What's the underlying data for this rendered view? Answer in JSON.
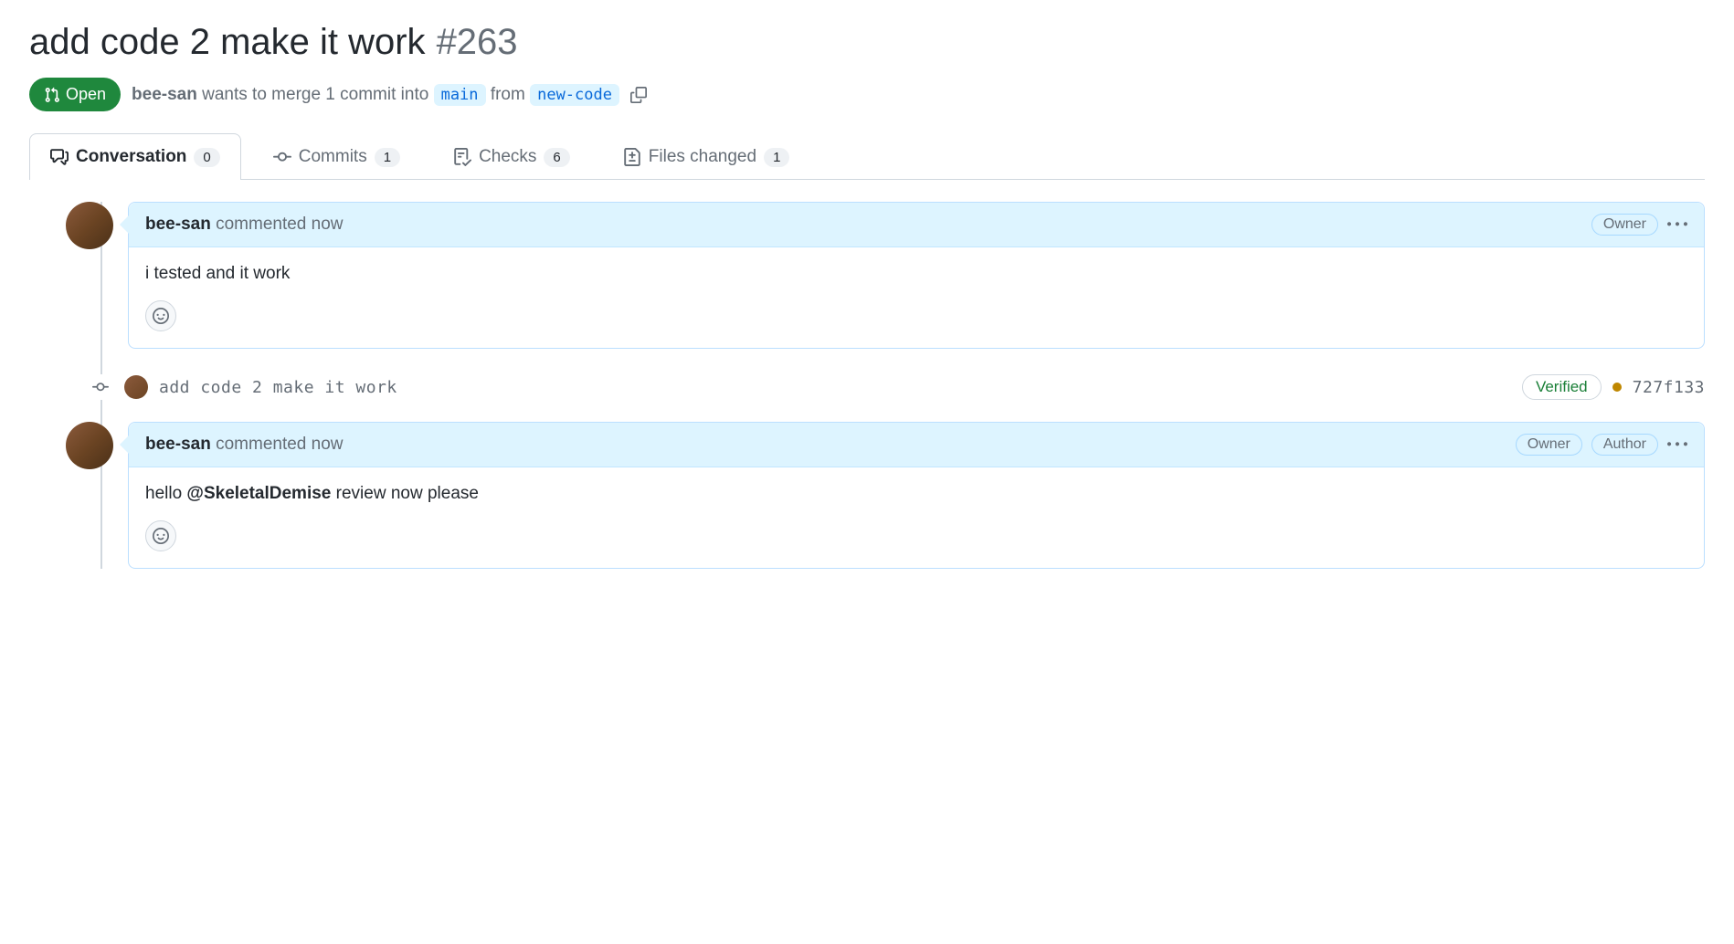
{
  "pr": {
    "title": "add code 2 make it work",
    "number": "#263",
    "state": "Open",
    "author": "bee-san",
    "merge_text_1": "wants to merge 1 commit into",
    "base_branch": "main",
    "merge_text_2": "from",
    "head_branch": "new-code"
  },
  "tabs": {
    "conversation": {
      "label": "Conversation",
      "count": "0"
    },
    "commits": {
      "label": "Commits",
      "count": "1"
    },
    "checks": {
      "label": "Checks",
      "count": "6"
    },
    "files": {
      "label": "Files changed",
      "count": "1"
    }
  },
  "comments": [
    {
      "author": "bee-san",
      "action": "commented",
      "time": "now",
      "badges": [
        "Owner"
      ],
      "body": "i tested and it work",
      "mention": ""
    },
    {
      "author": "bee-san",
      "action": "commented",
      "time": "now",
      "badges": [
        "Owner",
        "Author"
      ],
      "body_prefix": "hello ",
      "mention": "@SkeletalDemise",
      "body_suffix": " review now please"
    }
  ],
  "commit": {
    "message": "add code 2 make it work",
    "verified": "Verified",
    "sha": "727f133"
  }
}
